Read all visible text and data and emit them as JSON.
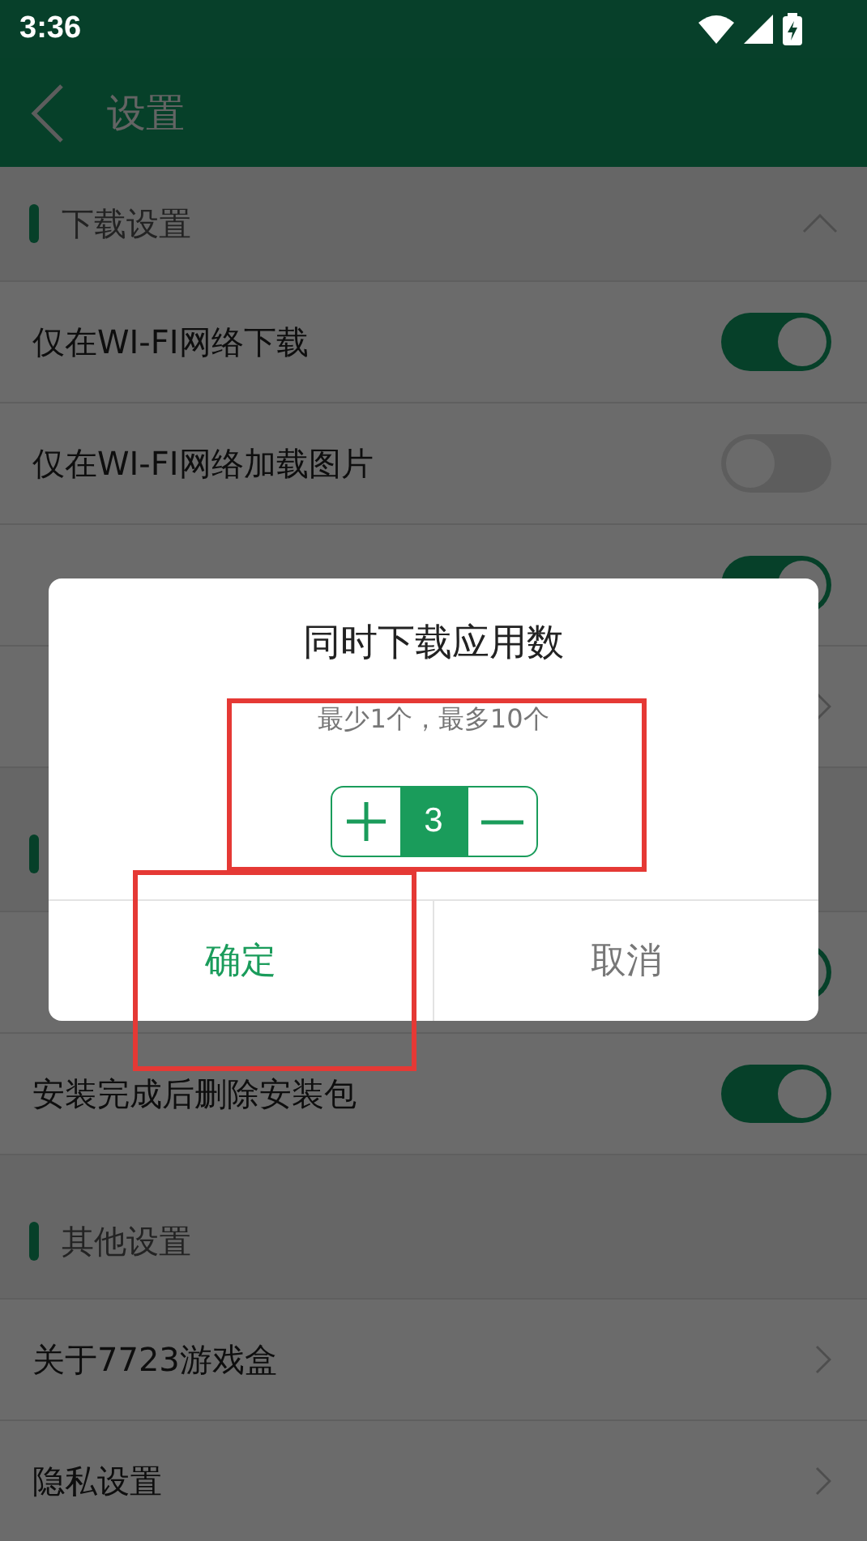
{
  "status_bar": {
    "time": "3:36"
  },
  "app_bar": {
    "title": "设置"
  },
  "sections": [
    {
      "title": "下载设置",
      "expanded": true,
      "rows": [
        {
          "kind": "toggle",
          "label": "仅在WI-FI网络下载",
          "on": true
        },
        {
          "kind": "toggle",
          "label": "仅在WI-FI网络加载图片",
          "on": false
        },
        {
          "kind": "toggle",
          "on": true
        },
        {
          "kind": "link"
        }
      ]
    },
    {
      "rows": [
        {
          "kind": "toggle",
          "on": true
        },
        {
          "kind": "toggle",
          "label": "安装完成后删除安装包",
          "on": true
        }
      ]
    },
    {
      "title": "其他设置",
      "rows": [
        {
          "kind": "link",
          "label": "关于7723游戏盒"
        },
        {
          "kind": "link",
          "label": "隐私设置"
        }
      ]
    }
  ],
  "dialog": {
    "title": "同时下载应用数",
    "hint": "最少1个，最多10个",
    "hint_highlighted": true,
    "value": "3",
    "buttons": [
      {
        "label": "确定",
        "kind": "primary",
        "highlighted": true
      },
      {
        "label": "取消",
        "kind": "secondary",
        "highlighted": false
      }
    ]
  }
}
